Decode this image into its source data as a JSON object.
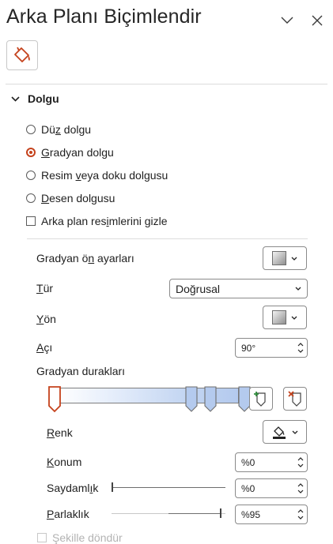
{
  "panel": {
    "title": "Arka Planı Biçimlendir",
    "section_title": "Dolgu"
  },
  "fill_options": {
    "solid": {
      "pre": "Dü",
      "u": "z",
      "post": " dolgu"
    },
    "gradient": {
      "pre": "",
      "u": "G",
      "post": "radyan dolgu"
    },
    "picture": {
      "pre": "Resim ",
      "u": "v",
      "post": "eya doku dolgusu"
    },
    "pattern": {
      "pre": "",
      "u": "D",
      "post": "esen dolgusu"
    },
    "selected": "gradient"
  },
  "hide_bg": {
    "pre": "Arka plan res",
    "u": "i",
    "post": "mlerini gizle",
    "checked": false
  },
  "gradient": {
    "presets": {
      "pre": "Gradyan ö",
      "u": "n",
      "post": " ayarları"
    },
    "type": {
      "pre": "",
      "u": "T",
      "post": "ür",
      "value": "Doğrusal"
    },
    "direction": {
      "pre": "",
      "u": "Y",
      "post": "ön"
    },
    "angle": {
      "pre": "",
      "u": "A",
      "post": "çı",
      "value": "90°"
    },
    "stops_label": "Gradyan durakları",
    "stops": [
      0.0,
      0.72,
      0.82,
      1.0
    ],
    "selected_stop": 0,
    "color": {
      "pre": "",
      "u": "R",
      "post": "enk"
    },
    "position": {
      "pre": "",
      "u": "K",
      "post": "onum",
      "value": "%0"
    },
    "transparency": {
      "pre": "Saydaml",
      "u": "ı",
      "post": "k",
      "value": "%0",
      "level": 0
    },
    "brightness": {
      "pre": "",
      "u": "P",
      "post": "arlaklık",
      "value": "%95",
      "level": 0.95
    },
    "rotate_with_shape": "Şekille döndür"
  },
  "colors": {
    "accent": "#c5421c",
    "bar_end": "#b4caee"
  }
}
